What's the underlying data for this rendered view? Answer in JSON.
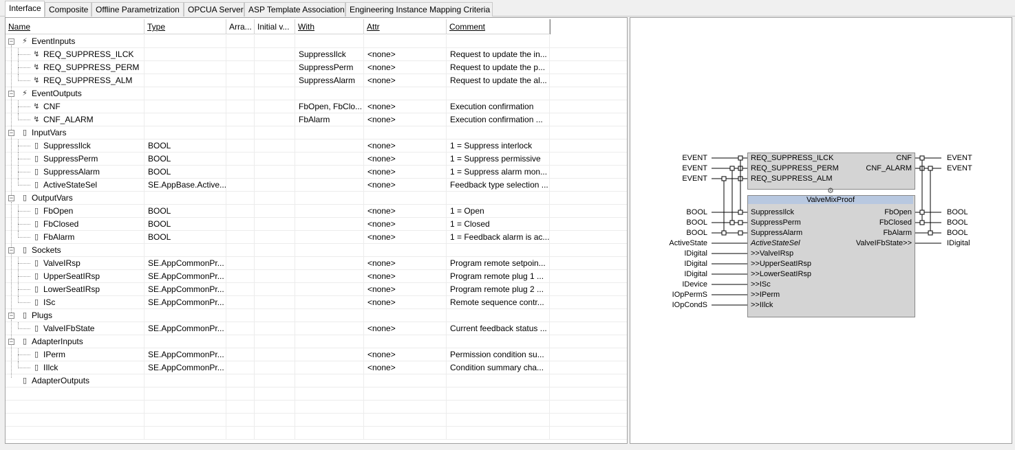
{
  "tabs": [
    {
      "label": "Interface",
      "active": true
    },
    {
      "label": "Composite"
    },
    {
      "label": "Offline Parametrization"
    },
    {
      "label": "OPCUA Server"
    },
    {
      "label": "ASP Template Association"
    },
    {
      "label": "Engineering Instance Mapping Criteria"
    }
  ],
  "columns": {
    "name": "Name",
    "type": "Type",
    "array": "Arra...",
    "initial": "Initial v...",
    "with": "With",
    "attr": "Attr",
    "comment": "Comment"
  },
  "rows": [
    {
      "kind": "group",
      "name": "EventInputs",
      "icon": "event-input-group-icon"
    },
    {
      "kind": "item",
      "name": "REQ_SUPPRESS_ILCK",
      "icon": "event-input-icon",
      "type": "",
      "with": "SuppressIlck",
      "attr": "<none>",
      "comment": "Request to update the in..."
    },
    {
      "kind": "item",
      "name": "REQ_SUPPRESS_PERM",
      "icon": "event-input-icon",
      "type": "",
      "with": "SuppressPerm",
      "attr": "<none>",
      "comment": "Request to update the p..."
    },
    {
      "kind": "item",
      "name": "REQ_SUPPRESS_ALM",
      "icon": "event-input-icon",
      "type": "",
      "with": "SuppressAlarm",
      "attr": "<none>",
      "comment": "Request to update the al...",
      "last": true
    },
    {
      "kind": "group",
      "name": "EventOutputs",
      "icon": "event-output-group-icon"
    },
    {
      "kind": "item",
      "name": "CNF",
      "icon": "event-output-icon",
      "type": "",
      "with": "FbOpen, FbClo...",
      "attr": "<none>",
      "comment": "Execution confirmation"
    },
    {
      "kind": "item",
      "name": "CNF_ALARM",
      "icon": "event-output-icon",
      "type": "",
      "with": "FbAlarm",
      "attr": "<none>",
      "comment": "Execution confirmation ...",
      "last": true
    },
    {
      "kind": "group",
      "name": "InputVars",
      "icon": "input-vars-group-icon"
    },
    {
      "kind": "item",
      "name": "SuppressIlck",
      "icon": "input-var-icon",
      "type": "BOOL",
      "with": "",
      "attr": "<none>",
      "comment": "1 = Suppress interlock"
    },
    {
      "kind": "item",
      "name": "SuppressPerm",
      "icon": "input-var-icon",
      "type": "BOOL",
      "with": "",
      "attr": "<none>",
      "comment": "1 = Suppress permissive"
    },
    {
      "kind": "item",
      "name": "SuppressAlarm",
      "icon": "input-var-icon",
      "type": "BOOL",
      "with": "",
      "attr": "<none>",
      "comment": "1 = Suppress alarm mon..."
    },
    {
      "kind": "item",
      "name": "ActiveStateSel",
      "icon": "input-var-icon",
      "type": "SE.AppBase.Active...",
      "with": "",
      "attr": "<none>",
      "comment": "Feedback type selection ...",
      "last": true
    },
    {
      "kind": "group",
      "name": "OutputVars",
      "icon": "output-vars-group-icon"
    },
    {
      "kind": "item",
      "name": "FbOpen",
      "icon": "output-var-icon",
      "type": "BOOL",
      "with": "",
      "attr": "<none>",
      "comment": "1 = Open"
    },
    {
      "kind": "item",
      "name": "FbClosed",
      "icon": "output-var-icon",
      "type": "BOOL",
      "with": "",
      "attr": "<none>",
      "comment": "1 = Closed"
    },
    {
      "kind": "item",
      "name": "FbAlarm",
      "icon": "output-var-icon",
      "type": "BOOL",
      "with": "",
      "attr": "<none>",
      "comment": "1 = Feedback alarm is ac...",
      "last": true
    },
    {
      "kind": "group",
      "name": "Sockets",
      "icon": "sockets-group-icon"
    },
    {
      "kind": "item",
      "name": "ValveIRsp",
      "icon": "socket-icon",
      "type": "SE.AppCommonPr...",
      "with": "",
      "attr": "<none>",
      "comment": "Program remote setpoin..."
    },
    {
      "kind": "item",
      "name": "UpperSeatIRsp",
      "icon": "socket-icon",
      "type": "SE.AppCommonPr...",
      "with": "",
      "attr": "<none>",
      "comment": "Program remote plug 1 ..."
    },
    {
      "kind": "item",
      "name": "LowerSeatIRsp",
      "icon": "socket-icon",
      "type": "SE.AppCommonPr...",
      "with": "",
      "attr": "<none>",
      "comment": "Program remote plug 2 ..."
    },
    {
      "kind": "item",
      "name": "ISc",
      "icon": "socket-icon",
      "type": "SE.AppCommonPr...",
      "with": "",
      "attr": "<none>",
      "comment": "Remote sequence contr...",
      "last": true
    },
    {
      "kind": "group",
      "name": "Plugs",
      "icon": "plugs-group-icon"
    },
    {
      "kind": "item",
      "name": "ValveIFbState",
      "icon": "plug-icon",
      "type": "SE.AppCommonPr...",
      "with": "",
      "attr": "<none>",
      "comment": "Current feedback status ...",
      "last": true
    },
    {
      "kind": "group",
      "name": "AdapterInputs",
      "icon": "adapter-inputs-group-icon"
    },
    {
      "kind": "item",
      "name": "IPerm",
      "icon": "adapter-input-icon",
      "type": "SE.AppCommonPr...",
      "with": "",
      "attr": "<none>",
      "comment": "Permission condition su..."
    },
    {
      "kind": "item",
      "name": "IIlck",
      "icon": "adapter-input-icon",
      "type": "SE.AppCommonPr...",
      "with": "",
      "attr": "<none>",
      "comment": "Condition summary cha...",
      "last": true
    },
    {
      "kind": "group",
      "name": "AdapterOutputs",
      "icon": "adapter-outputs-group-icon",
      "noexp": true
    },
    {
      "kind": "empty"
    },
    {
      "kind": "empty"
    },
    {
      "kind": "empty"
    },
    {
      "kind": "empty"
    }
  ],
  "fb": {
    "name": "ValveMixProof",
    "event_inputs": [
      "REQ_SUPPRESS_ILCK",
      "REQ_SUPPRESS_PERM",
      "REQ_SUPPRESS_ALM"
    ],
    "event_input_types": [
      "EVENT",
      "EVENT",
      "EVENT"
    ],
    "event_outputs": [
      "CNF",
      "CNF_ALARM"
    ],
    "event_output_types": [
      "EVENT",
      "EVENT"
    ],
    "data_inputs": [
      "SuppressIlck",
      "SuppressPerm",
      "SuppressAlarm",
      "ActiveStateSel",
      ">>ValveIRsp",
      ">>UpperSeatIRsp",
      ">>LowerSeatIRsp",
      ">>ISc",
      ">>IPerm",
      ">>IIlck"
    ],
    "data_input_types": [
      "BOOL",
      "BOOL",
      "BOOL",
      "ActiveState",
      "IDigital",
      "IDigital",
      "IDigital",
      "IDevice",
      "IOpPermS",
      "IOpCondS"
    ],
    "data_outputs": [
      "FbOpen",
      "FbClosed",
      "FbAlarm",
      "ValveIFbState>>"
    ],
    "data_output_types": [
      "BOOL",
      "BOOL",
      "BOOL",
      "IDigital"
    ],
    "header_color": "#b8c8e0",
    "body_color": "#d4d4d4"
  }
}
